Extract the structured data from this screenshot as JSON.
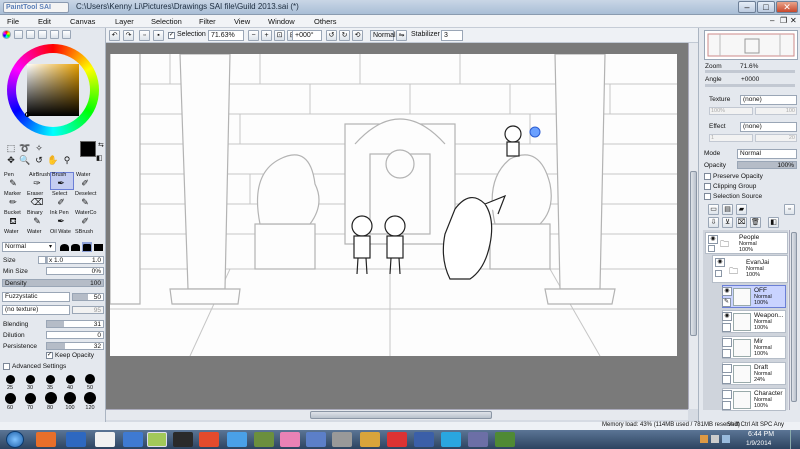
{
  "title_bar": {
    "logo": "PaintTool SAI",
    "title": "C:\\Users\\Kenny Li\\Pictures\\Drawings SAI file\\Guild 2013.sai (*)",
    "minimize": "–",
    "maximize": "□",
    "close": "✕"
  },
  "menu": [
    "File",
    "Edit",
    "Canvas",
    "Layer",
    "Selection",
    "Filter",
    "View",
    "Window",
    "Others"
  ],
  "toolbar": {
    "selection_label": "Selection",
    "zoom": "71.63%",
    "rotation": "+000°",
    "blend_mode": "Normal",
    "stabilizer_label": "Stabilizer",
    "stabilizer_value": "3"
  },
  "tools": {
    "row1": [
      "Pen",
      "AirBrush",
      "Brush",
      "Water"
    ],
    "row2": [
      "Marker",
      "Eraser",
      "Select",
      "Deselect"
    ],
    "row3": [
      "Bucket",
      "Binary",
      "Ink Pen",
      "WaterCo"
    ],
    "row4": [
      "Water",
      "Water",
      "Oil Wate",
      "SBrush"
    ],
    "selected": "Brush"
  },
  "brush": {
    "mode": "Normal",
    "size_label": "Size",
    "size_mult": "x 1.0",
    "size_value": "1.0",
    "size_pct": 0.01,
    "min_size_label": "Min Size",
    "min_size_value": "0%",
    "density_label": "Density",
    "density_value": "100",
    "shape": "Fuzzystatic",
    "shape_value": "50",
    "texture": "(no texture)",
    "texture_value": "95",
    "blending_label": "Blending",
    "blending_value": "31",
    "dilution_label": "Dilution",
    "dilution_value": "0",
    "persistence_label": "Persistence",
    "persistence_value": "32",
    "keep_opacity": "Keep Opacity",
    "advanced": "Advanced Settings",
    "sizes_row1": [
      "25",
      "30",
      "35",
      "40",
      "50"
    ],
    "sizes_row2": [
      "60",
      "70",
      "80",
      "100",
      "120"
    ]
  },
  "navigator": {
    "zoom_label": "Zoom",
    "zoom_value": "71.6%",
    "angle_label": "Angle",
    "angle_value": "+0000"
  },
  "layer_props": {
    "texture_label": "Texture",
    "texture_value": "(none)",
    "texture_scale": "100%",
    "texture_strength": "100",
    "effect_label": "Effect",
    "effect_value": "(none)",
    "effect_width": "1",
    "effect_strength": "20",
    "mode_label": "Mode",
    "mode_value": "Normal",
    "opacity_label": "Opacity",
    "opacity_value": "100%",
    "preserve_opacity": "Preserve Opacity",
    "clipping_group": "Clipping Group",
    "selection_source": "Selection Source"
  },
  "layers": [
    {
      "name": "People",
      "mode": "Normal",
      "opacity": "100%"
    },
    {
      "name": "EvanJai",
      "mode": "Normal",
      "opacity": "100%"
    },
    {
      "name": "OFF",
      "mode": "Normal",
      "opacity": "100%"
    },
    {
      "name": "Weapon...",
      "mode": "Normal",
      "opacity": "100%"
    },
    {
      "name": "Mir",
      "mode": "Normal",
      "opacity": "100%"
    },
    {
      "name": "Draft",
      "mode": "Normal",
      "opacity": "24%"
    },
    {
      "name": "Character",
      "mode": "Normal",
      "opacity": "100%"
    }
  ],
  "status": {
    "memory": "Memory load: 43% (114MB used / 781MB reserved)",
    "keys": "Shift Ctrl Alt SPC Any"
  },
  "taskbar": {
    "time": "6:44 PM",
    "date": "1/9/2014"
  },
  "colors": {
    "foreground": "#000000",
    "background": "#ffffff",
    "selected_layer": "#c9d3ff"
  }
}
